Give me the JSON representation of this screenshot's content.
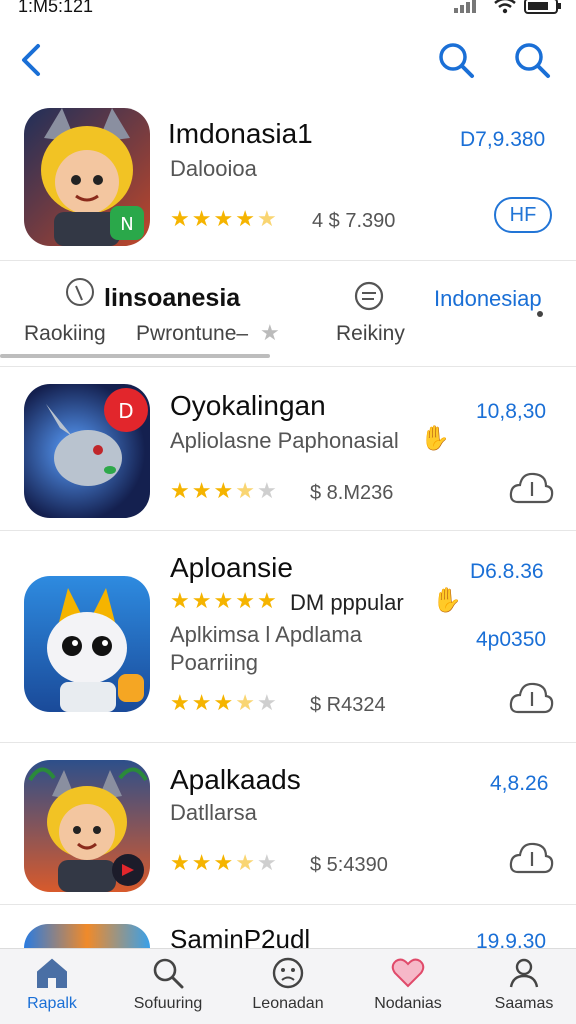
{
  "status": {
    "time": "1:M5:121"
  },
  "nav": {
    "back_icon": "chevron-left-icon",
    "search_icon": "search-icon"
  },
  "featured": {
    "title": "Imdonasia1",
    "subtitle": "Dalooioa",
    "price": "D7,9.380",
    "meta": "4 $ 7.390",
    "get_label": "HF",
    "rating": 4.5
  },
  "tabs": {
    "item1_top": "linsoanesia",
    "item1_left": "Raokiing",
    "item1_mid": "Pwrontune–",
    "item2": "Reikiny",
    "item3": "Indonesiap"
  },
  "apps": [
    {
      "title": "Oyokalingan",
      "subtitle": "Apliolasne Paphonasial",
      "price": "10,8,30",
      "meta": "$ 8.M236",
      "rating": 4.0
    },
    {
      "title": "Aploansie",
      "subtitle": "Aplkimsa l Apdlama",
      "subtitle2": "Poarriing",
      "badge": "DM pppular",
      "price_top": "D6.8.36",
      "price": "4p0350",
      "meta": "$ R4324",
      "rating": 4.0
    },
    {
      "title": "Apalkaads",
      "subtitle": "Datllarsa",
      "price": "4,8.26",
      "meta": "$ 5:4390",
      "rating": 4.0
    },
    {
      "title": "SaminP2udl",
      "price": "19.9.30"
    }
  ],
  "bottom_tabs": [
    {
      "label": "Rapalk",
      "icon": "home-icon"
    },
    {
      "label": "Sofuuring",
      "icon": "search-icon"
    },
    {
      "label": "Leonadan",
      "icon": "face-icon"
    },
    {
      "label": "Nodanias",
      "icon": "heart-icon"
    },
    {
      "label": "Saamas",
      "icon": "person-icon"
    }
  ]
}
